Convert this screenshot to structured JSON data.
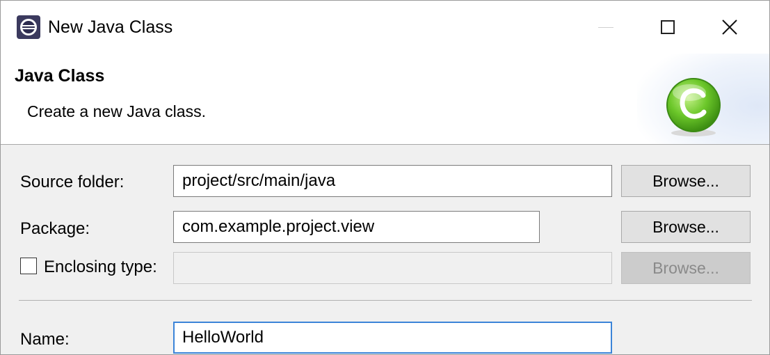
{
  "window": {
    "title": "New Java Class",
    "minimize_icon": "minimize-icon",
    "maximize_icon": "maximize-icon",
    "close_icon": "close-icon"
  },
  "banner": {
    "title": "Java Class",
    "description": "Create a new Java class.",
    "icon": "java-class-icon"
  },
  "form": {
    "source_folder": {
      "label": "Source folder:",
      "value": "project/src/main/java",
      "browse_label": "Browse..."
    },
    "package": {
      "label": "Package:",
      "value": "com.example.project.view",
      "browse_label": "Browse..."
    },
    "enclosing_type": {
      "label": "Enclosing type:",
      "checked": false,
      "value": "",
      "browse_label": "Browse...",
      "enabled": false
    },
    "name": {
      "label": "Name:",
      "value": "HelloWorld"
    }
  },
  "colors": {
    "focus_border": "#3b84d8",
    "class_icon_green": "#5cbf1e"
  }
}
